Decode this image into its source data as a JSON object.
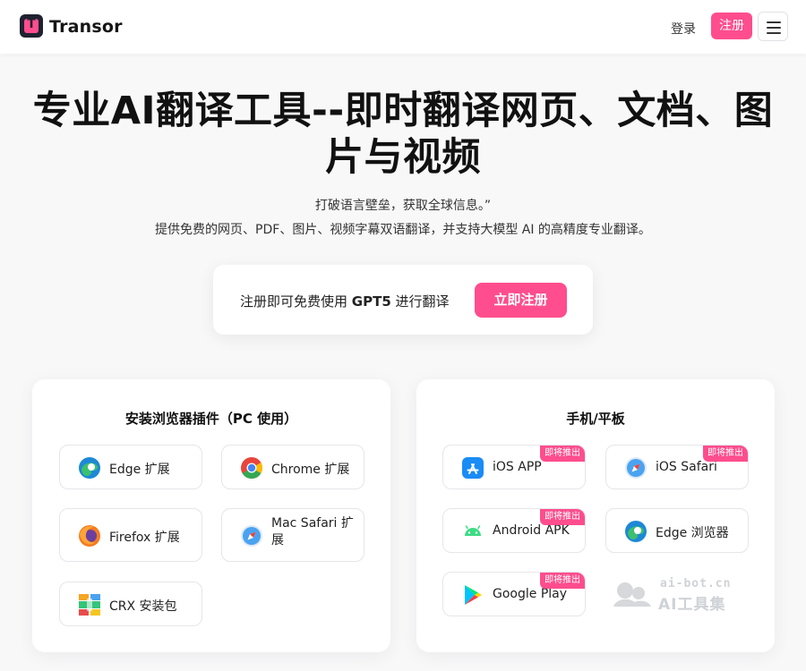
{
  "header": {
    "logo_letter": "T",
    "brand": "Transor",
    "login_label": "登录",
    "signup_label": "注册"
  },
  "hero": {
    "title_line1": "专业AI翻译工具--即时翻译网页、文档、图",
    "title_line2": "片与视频",
    "subtitle1": "打破语言壁垒，获取全球信息。”",
    "subtitle2": "提供免费的网页、PDF、图片、视频字幕双语翻译，并支持大模型 AI 的高精度专业翻译。",
    "cta_text_prefix": "注册即可免费使用 ",
    "cta_model": "GPT5",
    "cta_text_suffix": " 进行翻译",
    "cta_button": "立即注册"
  },
  "panels": {
    "pc": {
      "title": "安装浏览器插件（PC 使用）",
      "items": [
        {
          "label": "Edge 扩展",
          "icon": "edge-icon"
        },
        {
          "label": "Chrome 扩展",
          "icon": "chrome-icon"
        },
        {
          "label": "Firefox 扩展",
          "icon": "firefox-icon"
        },
        {
          "label": "Mac Safari 扩展",
          "icon": "safari-icon"
        },
        {
          "label": "CRX 安装包",
          "icon": "crx-package-icon"
        }
      ]
    },
    "mobile": {
      "title": "手机/平板",
      "items": [
        {
          "label": "iOS APP",
          "icon": "app-store-icon",
          "badge": "即将推出"
        },
        {
          "label": "iOS Safari",
          "icon": "safari-icon",
          "badge": "即将推出"
        },
        {
          "label": "Android APK",
          "icon": "android-icon",
          "badge": "即将推出"
        },
        {
          "label": "Edge 浏览器",
          "icon": "edge-icon"
        },
        {
          "label": "Google Play",
          "icon": "google-play-icon",
          "badge": "即将推出"
        }
      ]
    }
  },
  "watermark": {
    "line1": "ai-bot.cn",
    "line2": "AI工具集"
  },
  "colors": {
    "accent": "#ff4d8d",
    "logo_bg": "#1f2230",
    "background": "#f8f8f9"
  }
}
